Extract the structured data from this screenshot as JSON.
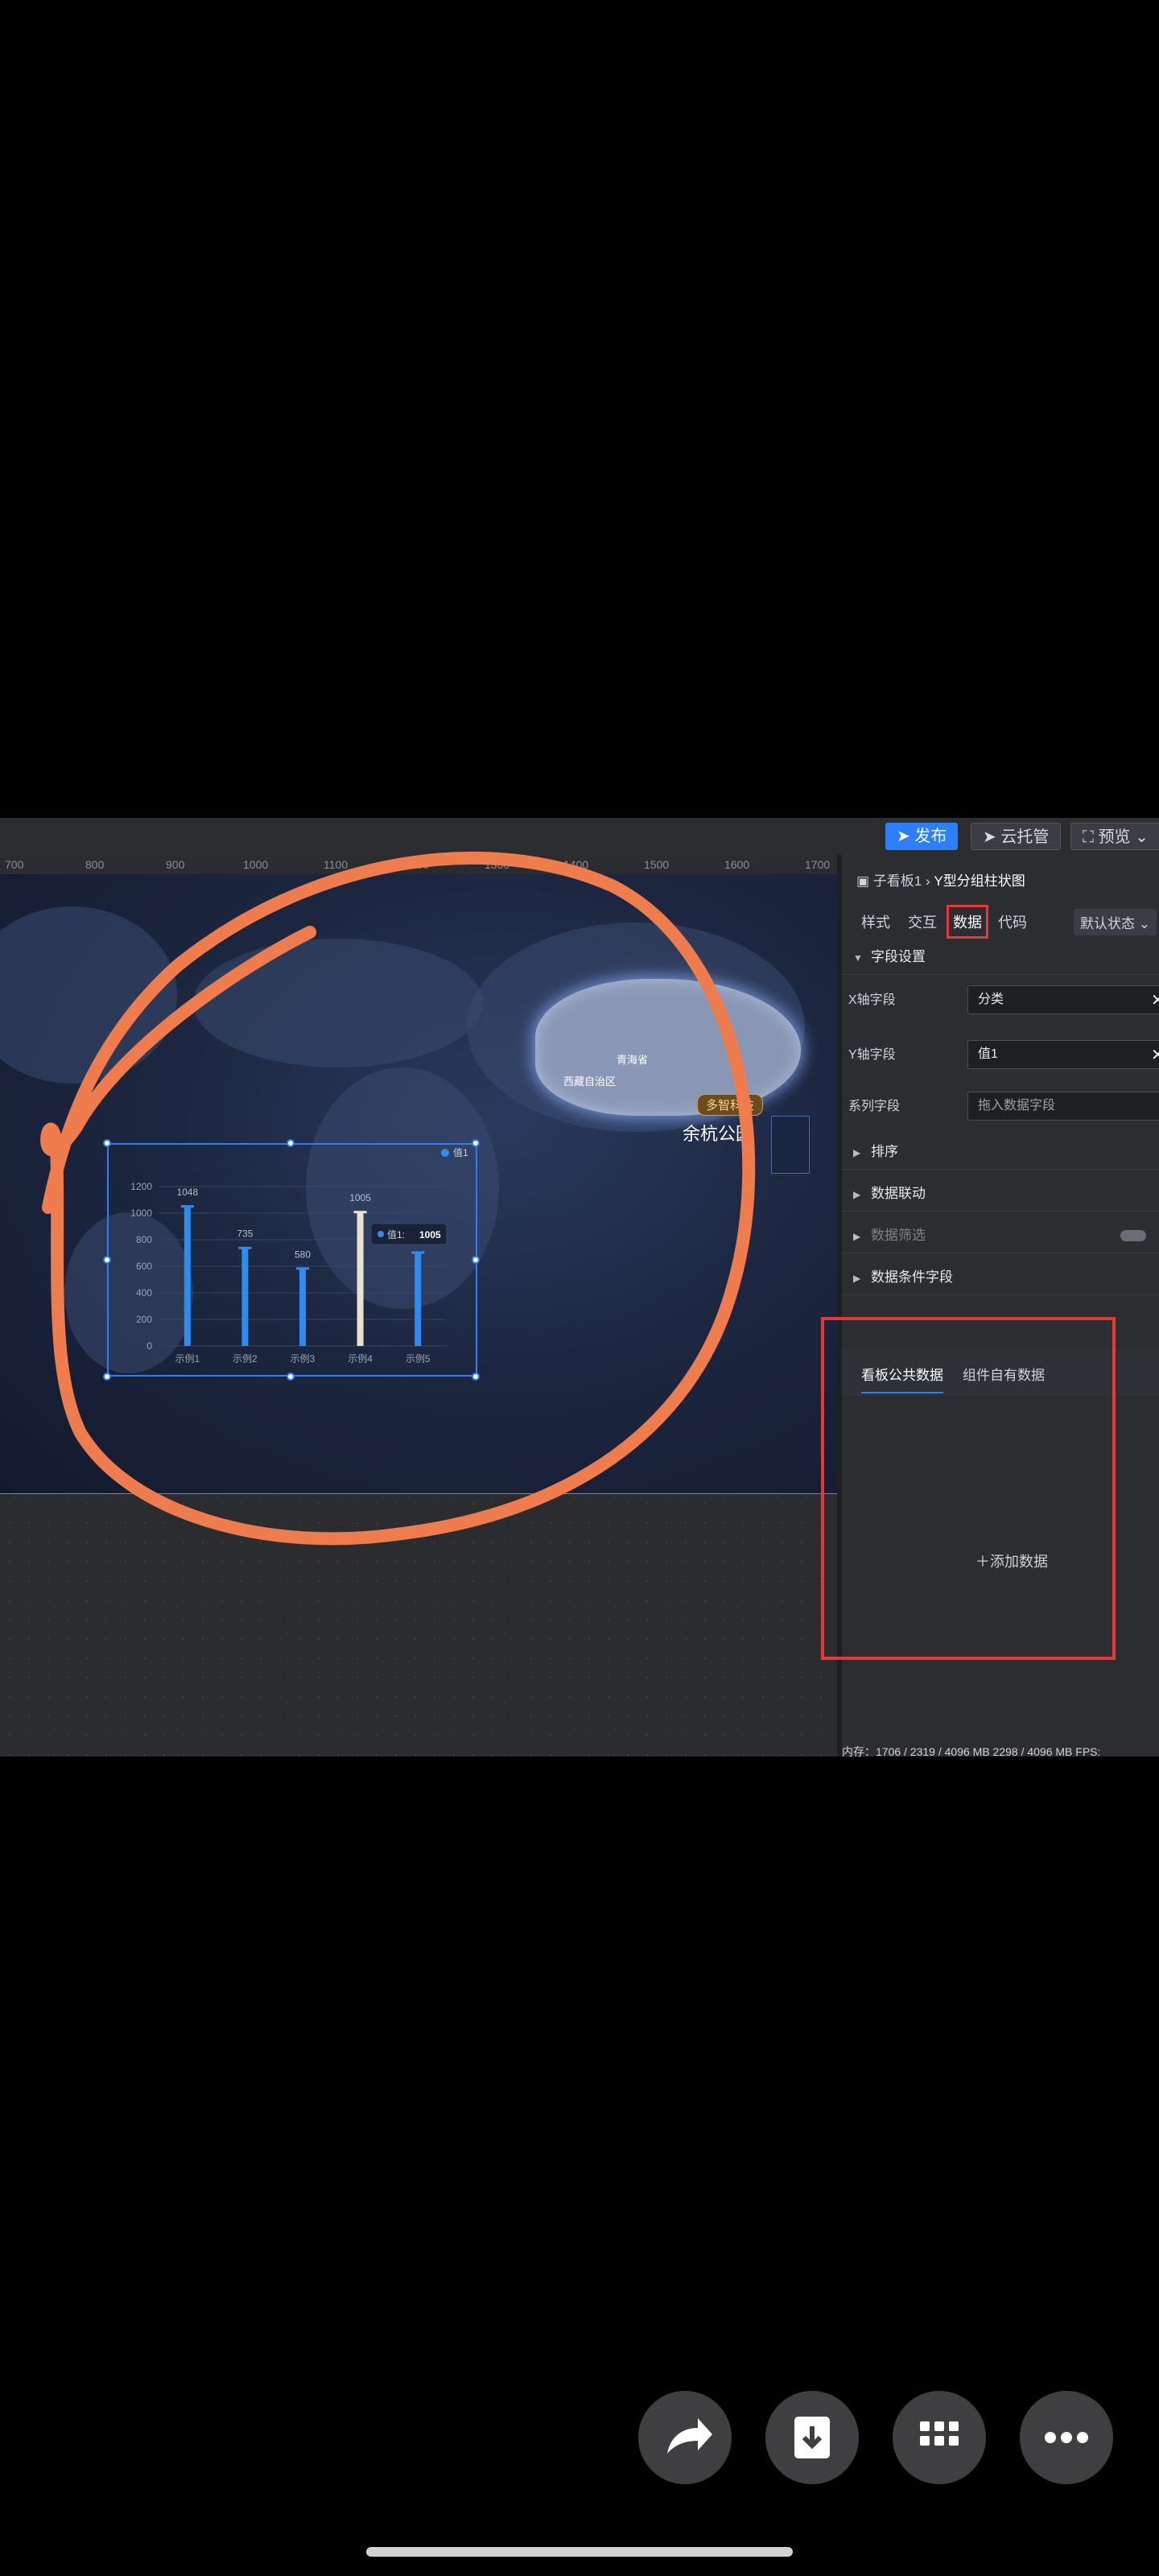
{
  "toolbar": {
    "publish_label": "发布",
    "cloud_label": "云托管",
    "preview_label": "预览"
  },
  "ruler": {
    "ticks": [
      "700",
      "800",
      "900",
      "1000",
      "1100",
      "1200",
      "1300",
      "1400",
      "1500",
      "1600",
      "1700"
    ]
  },
  "map": {
    "badge": "多智科技",
    "park_title": "余杭公园",
    "labels": [
      "青海省",
      "西藏自治区"
    ]
  },
  "chart_data": {
    "type": "bar",
    "categories": [
      "示例1",
      "示例2",
      "示例3",
      "示例4",
      "示例5"
    ],
    "series": [
      {
        "name": "值1",
        "values": [
          1048,
          735,
          580,
          1005,
          700
        ]
      }
    ],
    "data_labels": [
      "1048",
      "735",
      "580",
      "1005",
      ""
    ],
    "y_ticks": [
      "0",
      "200",
      "400",
      "600",
      "800",
      "1000",
      "1200"
    ],
    "ylim": [
      0,
      1200
    ],
    "tooltip": {
      "label": "值1",
      "value": "1005"
    },
    "highlight_index": 3,
    "colors": {
      "bar": "#2d8cf0",
      "highlight": "#e8e2cf"
    }
  },
  "panel": {
    "breadcrumb_parent": "子看板1",
    "breadcrumb_current": "Y型分组柱状图",
    "tabs": [
      "样式",
      "交互",
      "数据",
      "代码"
    ],
    "state_select": "默认状态",
    "field_settings": "字段设置",
    "x_field_label": "X轴字段",
    "x_field_value": "分类",
    "y_field_label": "Y轴字段",
    "y_field_value": "值1",
    "series_field_label": "系列字段",
    "series_field_placeholder": "拖入数据字段",
    "sections": [
      "排序",
      "数据联动",
      "数据筛选",
      "数据条件字段"
    ],
    "data_tabs": [
      "看板公共数据",
      "组件自有数据"
    ],
    "add_data": "添加数据",
    "status": "内存：1706 / 2319 / 4096 MB  2298 / 4096 MB   FPS:"
  },
  "phone": {
    "icons": [
      "share-icon",
      "download-icon",
      "grid-icon",
      "more-icon"
    ]
  }
}
